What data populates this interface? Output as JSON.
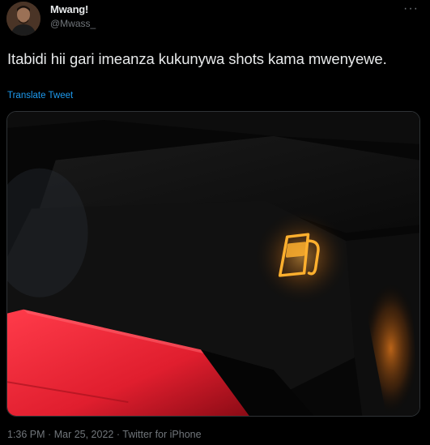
{
  "author": {
    "display_name": "Mwang!",
    "handle": "@Mwass_"
  },
  "menu_icon": "more-horizontal-icon",
  "tweet": {
    "text": "Itabidi hii gari imeanza kukunywa shots kama mwenyewe.",
    "translate_label": "Translate Tweet"
  },
  "media": {
    "subject": "fuel-warning-light-icon",
    "warning_color": "#f5a623"
  },
  "footer": {
    "time": "1:36 PM",
    "date": "Mar 25, 2022",
    "source": "Twitter for iPhone",
    "separator": "·"
  },
  "colors": {
    "background": "#000000",
    "text": "#e7e9ea",
    "secondary": "#71767b",
    "link": "#1d9bf0"
  }
}
